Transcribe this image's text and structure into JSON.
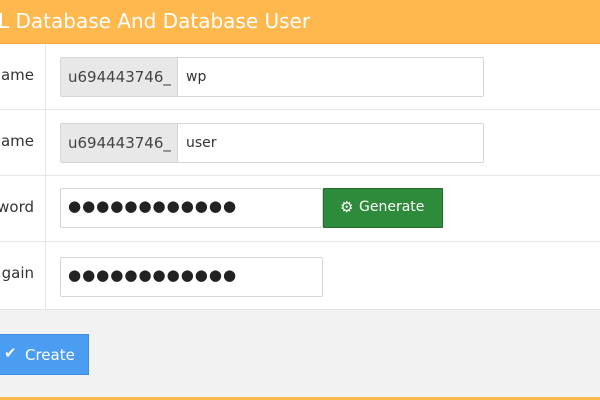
{
  "panel": {
    "title": "L Database And Database User"
  },
  "form": {
    "db_name": {
      "label": "ame",
      "prefix": "u694443746_",
      "value": "wp"
    },
    "username": {
      "label": "ame",
      "prefix": "u694443746_",
      "value": "user"
    },
    "password": {
      "label": "word",
      "value": "●●●●●●●●●●●●"
    },
    "password_again": {
      "label": "gain",
      "value": "●●●●●●●●●●●●"
    }
  },
  "buttons": {
    "generate": {
      "label": "Generate",
      "icon": "gear-icon"
    },
    "create": {
      "label": "Create",
      "icon": "check-icon"
    }
  },
  "colors": {
    "header": "#ffb84d",
    "generate_button": "#2e8b3b",
    "create_button": "#4a9df0"
  }
}
